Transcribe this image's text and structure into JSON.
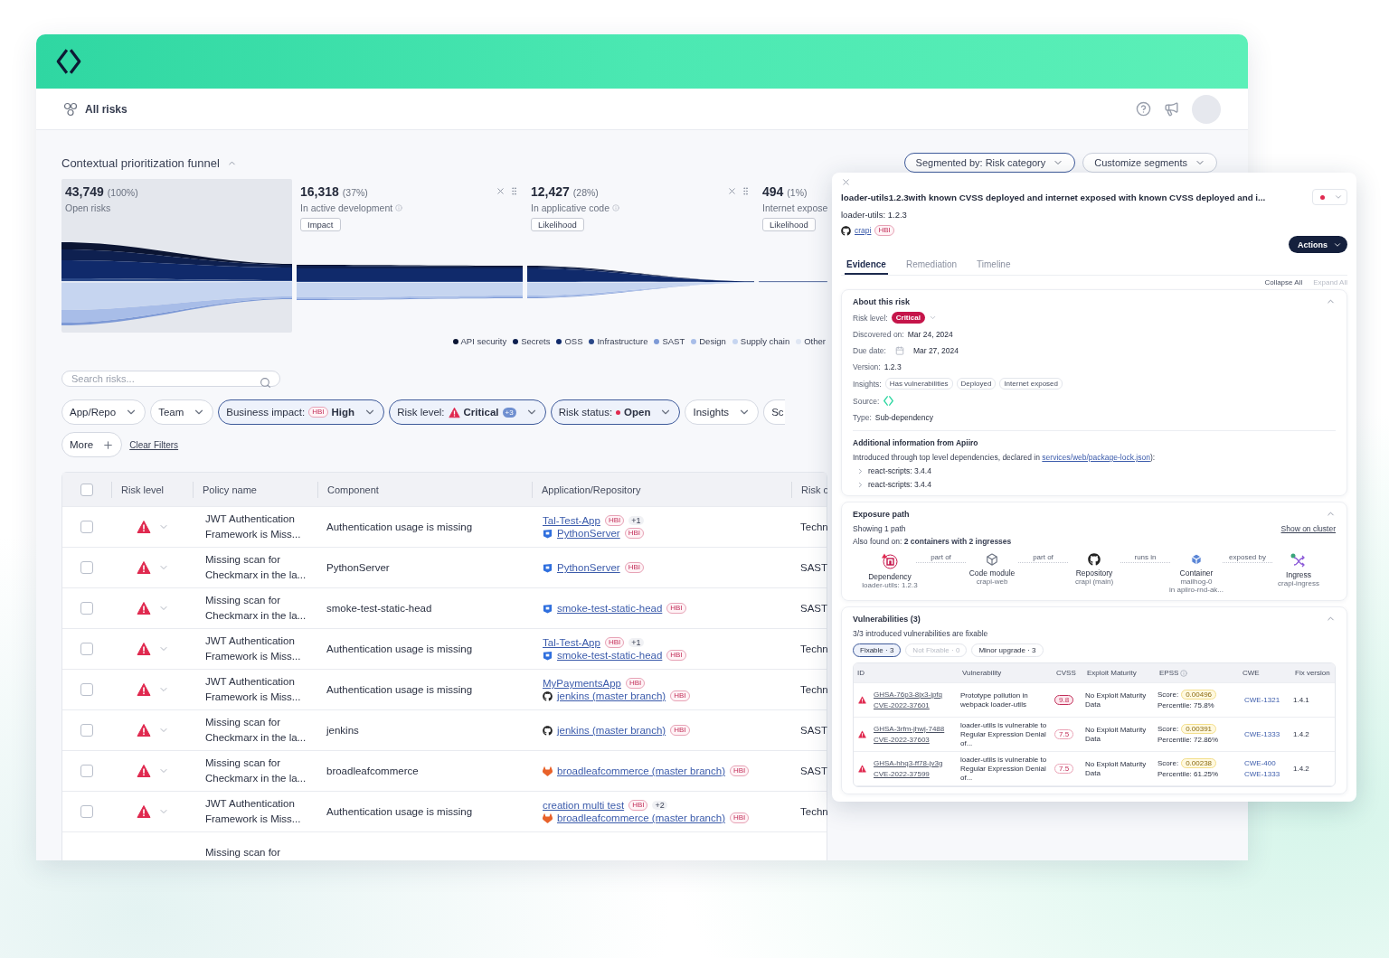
{
  "topbar": {
    "title": "All risks"
  },
  "funnel": {
    "title": "Contextual prioritization funnel",
    "expanded": true,
    "segment_buttons": [
      "Segmented by: Risk category",
      "Customize segments"
    ],
    "stages": [
      {
        "value": "43,749",
        "share": "(100%)",
        "label": "Open risks",
        "selected": true,
        "removable": false,
        "info": false
      },
      {
        "value": "16,318",
        "share": "(37%)",
        "label": "In active development",
        "tag": "Impact",
        "selected": false,
        "removable": true,
        "info": true
      },
      {
        "value": "12,427",
        "share": "(28%)",
        "label": "In applicative code",
        "tag": "Likelihood",
        "selected": false,
        "removable": true,
        "info": true
      },
      {
        "value": "494",
        "share": "(1%)",
        "label": "Internet expose",
        "tag": "Likelihood",
        "selected": false,
        "removable": false
      }
    ],
    "legend": [
      {
        "label": "API security",
        "color": "#0b1533"
      },
      {
        "label": "Secrets",
        "color": "#0e2050"
      },
      {
        "label": "OSS",
        "color": "#102a6b"
      },
      {
        "label": "Infrastructure",
        "color": "#2a4888"
      },
      {
        "label": "SAST",
        "color": "#7e9ad6"
      },
      {
        "label": "Design",
        "color": "#a8bde8"
      },
      {
        "label": "Supply chain",
        "color": "#c6d5f0"
      },
      {
        "label": "Other",
        "color": "#dfe6f3"
      }
    ]
  },
  "search": {
    "placeholder": "Search risks..."
  },
  "filters": [
    {
      "kind": "plain",
      "label": "App/Repo",
      "active": false
    },
    {
      "kind": "plain",
      "label": "Team",
      "active": false
    },
    {
      "kind": "impact",
      "label": "Business impact:",
      "badge": "HBI",
      "value": "High",
      "active": true
    },
    {
      "kind": "level",
      "label": "Risk level:",
      "value": "Critical",
      "count": "+3",
      "active": true
    },
    {
      "kind": "status",
      "label": "Risk status:",
      "value": "Open",
      "active": true
    },
    {
      "kind": "plain",
      "label": "Insights",
      "active": false
    },
    {
      "kind": "cut",
      "label": "Sc",
      "active": false
    }
  ],
  "more_button": "More",
  "clear_filters": "Clear Filters",
  "table": {
    "all_checked": false,
    "columns": [
      "Risk level",
      "Policy name",
      "Component",
      "Application/Repository",
      "Risk c"
    ],
    "rows": [
      {
        "kind": "row",
        "checked": false,
        "policy": "JWT Authentication Framework is Miss...",
        "component": "Authentication usage is missing",
        "apps": [
          {
            "kind": "app",
            "name": "Tal-Test-App",
            "hbi": "HBI",
            "extra": "+1"
          },
          {
            "kind": "shield",
            "name": "PythonServer",
            "hbi": "HBI"
          }
        ],
        "category": "Techn"
      },
      {
        "kind": "row",
        "checked": false,
        "policy": "Missing scan for Checkmarx in the la...",
        "component": "PythonServer",
        "apps": [
          {
            "kind": "shield",
            "name": "PythonServer",
            "hbi": "HBI"
          }
        ],
        "category": "SAST"
      },
      {
        "kind": "row",
        "checked": false,
        "policy": "Missing scan for Checkmarx in the la...",
        "component": "smoke-test-static-head",
        "apps": [
          {
            "kind": "shield",
            "name": "smoke-test-static-head",
            "hbi": "HBI"
          }
        ],
        "category": "SAST"
      },
      {
        "kind": "row",
        "checked": false,
        "policy": "JWT Authentication Framework is Miss...",
        "component": "Authentication usage is missing",
        "apps": [
          {
            "kind": "app",
            "name": "Tal-Test-App",
            "hbi": "HBI",
            "extra": "+1"
          },
          {
            "kind": "shield",
            "name": "smoke-test-static-head",
            "hbi": "HBI"
          }
        ],
        "category": "Techn"
      },
      {
        "kind": "row",
        "checked": false,
        "policy": "JWT Authentication Framework is Miss...",
        "component": "Authentication usage is missing",
        "apps": [
          {
            "kind": "app",
            "name": "MyPaymentsApp",
            "hbi": "HBI"
          },
          {
            "kind": "cat",
            "name": "jenkins (master branch)",
            "hbi": "HBI"
          }
        ],
        "category": "Techn"
      },
      {
        "kind": "row",
        "checked": false,
        "policy": "Missing scan for Checkmarx in the la...",
        "component": "jenkins",
        "apps": [
          {
            "kind": "cat",
            "name": "jenkins (master branch)",
            "hbi": "HBI"
          }
        ],
        "category": "SAST"
      },
      {
        "kind": "row",
        "checked": false,
        "policy": "Missing scan for Checkmarx in the la...",
        "component": "broadleafcommerce",
        "apps": [
          {
            "kind": "fox",
            "name": "broadleafcommerce (master branch)",
            "hbi": "HBI"
          }
        ],
        "category": "SAST"
      },
      {
        "kind": "row",
        "checked": false,
        "policy": "JWT Authentication Framework is Miss...",
        "component": "Authentication usage is missing",
        "apps": [
          {
            "kind": "app",
            "name": "creation multi test",
            "hbi": "HBI",
            "extra": "+2"
          },
          {
            "kind": "fox",
            "name": "broadleafcommerce (master branch)",
            "hbi": "HBI"
          }
        ],
        "category": "Techn"
      },
      {
        "kind": "cut",
        "policy": "Missing scan for"
      }
    ]
  },
  "panel": {
    "title": "loader-utils1.2.3with known CVSS deployed and internet exposed with known CVSS deployed and i...",
    "subtitle": "loader-utils: 1.2.3",
    "repo": {
      "name": "crapi",
      "hbi": "HBI"
    },
    "actions": "Actions",
    "tabs": [
      {
        "label": "Evidence",
        "selected": true
      },
      {
        "label": "Remediation",
        "selected": false
      },
      {
        "label": "Timeline",
        "selected": false
      }
    ],
    "toggles": [
      {
        "label": "Collapse All",
        "disabled": false
      },
      {
        "label": "Expand All",
        "disabled": true
      }
    ],
    "about": {
      "title": "About this risk",
      "expanded": true,
      "fields": [
        {
          "kind": "badge",
          "label": "Risk level:",
          "value": "Critical"
        },
        {
          "kind": "text",
          "label": "Discovered on:",
          "value": "Mar 24, 2024"
        },
        {
          "kind": "date",
          "label": "Due date:",
          "value": "Mar 27, 2024"
        },
        {
          "kind": "text",
          "label": "Version:",
          "value": "1.2.3"
        },
        {
          "kind": "chips",
          "label": "Insights:",
          "chips": [
            "Has vulnerabilities",
            "Deployed",
            "Internet exposed"
          ]
        },
        {
          "kind": "logo",
          "label": "Source:"
        },
        {
          "kind": "text",
          "label": "Type:",
          "value": "Sub-dependency"
        }
      ],
      "extra_title": "Additional information from Apiiro",
      "intro": "Introduced through top level dependencies, declared in",
      "intro_link": "services/web/package-lock.json",
      "intro_end": "):",
      "deps": [
        {
          "label": "react-scripts: 3.4.4",
          "expanded": false
        },
        {
          "label": "react-scripts: 3.4.4",
          "expanded": false
        }
      ]
    },
    "exposure": {
      "title": "Exposure path",
      "expanded": true,
      "showing": "Showing 1 path",
      "cluster_link": "Show on cluster",
      "also": "Also found on: **2 containers with 2 ingresses**",
      "nodes": [
        {
          "kind": "dependency",
          "title": "Dependency",
          "sub": [
            "loader-utils: 1.2.3"
          ]
        },
        {
          "kind": "module",
          "title": "Code module",
          "sub": [
            "crapi-web"
          ]
        },
        {
          "kind": "repository",
          "title": "Repository",
          "sub": [
            "crapi (main)"
          ]
        },
        {
          "kind": "container",
          "title": "Container",
          "sub": [
            "mailhog-0",
            "in apiiro-rnd-ak..."
          ]
        },
        {
          "kind": "ingress",
          "title": "Ingress",
          "sub": [
            "crapi-ingress"
          ]
        }
      ],
      "edges": [
        "part of",
        "part of",
        "runs in",
        "exposed by"
      ]
    },
    "vulns": {
      "title": "Vulnerabilities (3)",
      "expanded": true,
      "summary": "3/3 introduced vulnerabilities are fixable",
      "chips": [
        {
          "label": "Fixable · 3",
          "selected": true,
          "disabled": false
        },
        {
          "label": "Not Fixable · 0",
          "selected": false,
          "disabled": true
        },
        {
          "label": "Minor upgrade · 3",
          "selected": false,
          "disabled": false
        }
      ],
      "columns": [
        "ID",
        "Vulnerability",
        "CVSS",
        "Exploit Maturity",
        "EPSS",
        "CWE",
        "Fix version"
      ],
      "rows": [
        {
          "ids": [
            "GHSA-76p3-8jx3-jpfq",
            "CVE-2022-37601"
          ],
          "name": "Prototype pollution in webpack loader-utils",
          "cvss": "9.8",
          "critical": true,
          "maturity": "No Exploit Maturity Data",
          "score_label": "Score:",
          "score": "0.00496",
          "percentile": "Percentile: 75.8%",
          "cwe": [
            "CWE-1321"
          ],
          "fix": "1.4.1"
        },
        {
          "ids": [
            "GHSA-3rfm-jhwj-7488",
            "CVE-2022-37603"
          ],
          "name": "loader-utils is vulnerable to Regular Expression Denial of...",
          "cvss": "7.5",
          "critical": false,
          "maturity": "No Exploit Maturity Data",
          "score_label": "Score:",
          "score": "0.00391",
          "percentile": "Percentile: 72.86%",
          "cwe": [
            "CWE-1333"
          ],
          "fix": "1.4.2"
        },
        {
          "ids": [
            "GHSA-hhq3-ff78-jv3g",
            "CVE-2022-37599"
          ],
          "name": "loader-utils is vulnerable to Regular Expression Denial of...",
          "cvss": "7.5",
          "critical": false,
          "maturity": "No Exploit Maturity Data",
          "score_label": "Score:",
          "score": "0.00238",
          "percentile": "Percentile: 61.25%",
          "cwe": [
            "CWE-400",
            "CWE-1333"
          ],
          "fix": "1.4.2"
        }
      ]
    }
  }
}
